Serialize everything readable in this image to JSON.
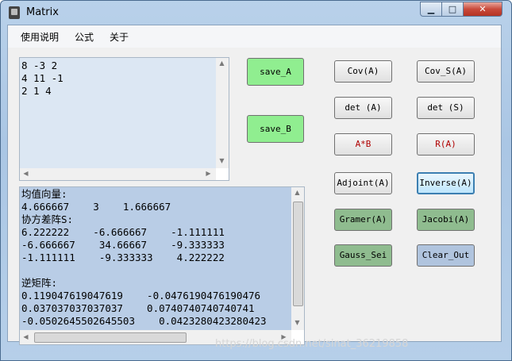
{
  "window": {
    "title": "Matrix",
    "controls": {
      "minimize": "▁",
      "maximize": "□",
      "close": "✕"
    }
  },
  "menu": [
    "使用说明",
    "公式",
    "关于"
  ],
  "matrix_input": {
    "text": "8 -3 2\n4 11 -1\n2 1 4"
  },
  "output": {
    "text": "均值向量:\n4.666667    3    1.666667\n协方差阵S:\n6.222222    -6.666667    -1.111111\n-6.666667    34.66667    -9.333333\n-1.111111    -9.333333    4.222222\n\n逆矩阵:\n0.119047619047619    -0.0476190476190476\n0.037037037037037    0.0740740740740741\n-0.0502645502645503    0.0423280423280423"
  },
  "buttons": {
    "save_a": "save_A",
    "save_b": "save_B",
    "cov_a": "Cov(A)",
    "cov_s_a": "Cov_S(A)",
    "det_a": "det (A)",
    "det_s": "det (S)",
    "a_times_b": "A*B",
    "r_a": "R(A)",
    "adjoint_a": "Adjoint(A)",
    "inverse_a": "Inverse(A)",
    "gramer_a": "Gramer(A)",
    "jacobi_a": "Jacobi(A)",
    "gauss_sei": "Gauss_Sei",
    "clear_out": "Clear_Out"
  },
  "watermark": "https://blog.csdn.net/sinat_36219858",
  "colors": {
    "save_buttons": "#90ee90",
    "gramer_jacobi_gauss": "#8fbc8f",
    "clear_out": "#b0c4de",
    "input_area": "#dce7f3",
    "output_area": "#b9cde6",
    "red_text": "#b00000"
  }
}
